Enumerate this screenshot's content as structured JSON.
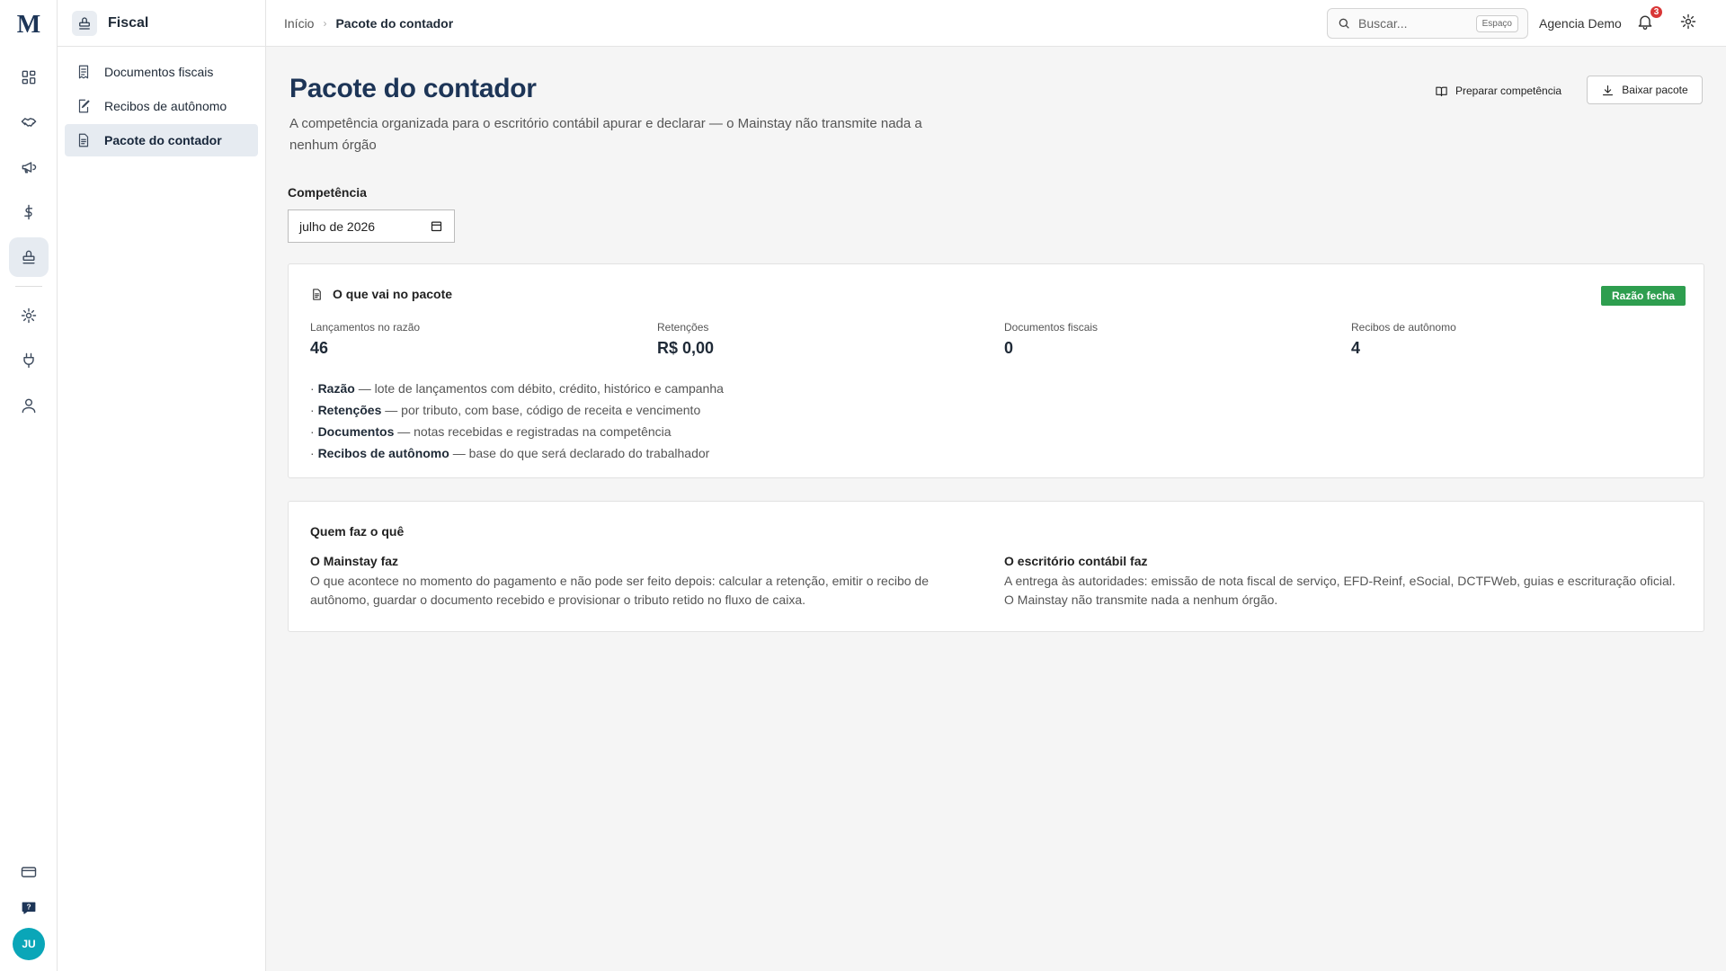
{
  "brand": {
    "logo_text": "M",
    "logo_color": "#1d3557"
  },
  "rail": {
    "items": [
      "dashboard-icon",
      "handshake-icon",
      "megaphone-icon",
      "dollar-icon",
      "stamp-icon",
      "gear-icon",
      "plug-icon",
      "user-icon",
      "credit-card-icon",
      "help-icon"
    ],
    "active": "stamp-icon",
    "avatar_initials": "JU",
    "avatar_color": "#0aa6b8"
  },
  "sidebar": {
    "title": "Fiscal",
    "items": [
      {
        "label": "Documentos fiscais",
        "icon": "receipt-icon"
      },
      {
        "label": "Recibos de autônomo",
        "icon": "edit-doc-icon"
      },
      {
        "label": "Pacote do contador",
        "icon": "file-icon",
        "active": true
      }
    ]
  },
  "topbar": {
    "breadcrumbs": [
      "Início",
      "Pacote do contador"
    ],
    "search": {
      "placeholder": "Buscar...",
      "shortcut": "Espaço"
    },
    "org_name": "Agencia Demo",
    "notifications_count": "3"
  },
  "page": {
    "title": "Pacote do contador",
    "subtitle": "A competência organizada para o escritório contábil apurar e declarar — o Mainstay não transmite nada a nenhum órgão",
    "actions": {
      "prepare_label": "Preparar competência",
      "download_label": "Baixar pacote"
    },
    "period": {
      "label": "Competência",
      "value": "julho de 2026"
    }
  },
  "package_card": {
    "title": "O que vai no pacote",
    "status": "Razão fecha",
    "status_color": "#2e9e4f",
    "stats": [
      {
        "label": "Lançamentos no razão",
        "value": "46"
      },
      {
        "label": "Retenções",
        "value": "R$ 0,00"
      },
      {
        "label": "Documentos fiscais",
        "value": "0"
      },
      {
        "label": "Recibos de autônomo",
        "value": "4"
      }
    ],
    "bullets": [
      {
        "term": "Razão",
        "desc": "— lote de lançamentos com débito, crédito, histórico e campanha"
      },
      {
        "term": "Retenções",
        "desc": "— por tributo, com base, código de receita e vencimento"
      },
      {
        "term": "Documentos",
        "desc": "— notas recebidas e registradas na competência"
      },
      {
        "term": "Recibos de autônomo",
        "desc": "— base do que será declarado do trabalhador"
      }
    ]
  },
  "roles_card": {
    "title": "Quem faz o quê",
    "columns": [
      {
        "heading": "O Mainstay faz",
        "text": "O que acontece no momento do pagamento e não pode ser feito depois: calcular a retenção, emitir o recibo de autônomo, guardar o documento recebido e provisionar o tributo retido no fluxo de caixa."
      },
      {
        "heading": "O escritório contábil faz",
        "text": "A entrega às autoridades: emissão de nota fiscal de serviço, EFD-Reinf, eSocial, DCTFWeb, guias e escrituração oficial. O Mainstay não transmite nada a nenhum órgão."
      }
    ]
  }
}
